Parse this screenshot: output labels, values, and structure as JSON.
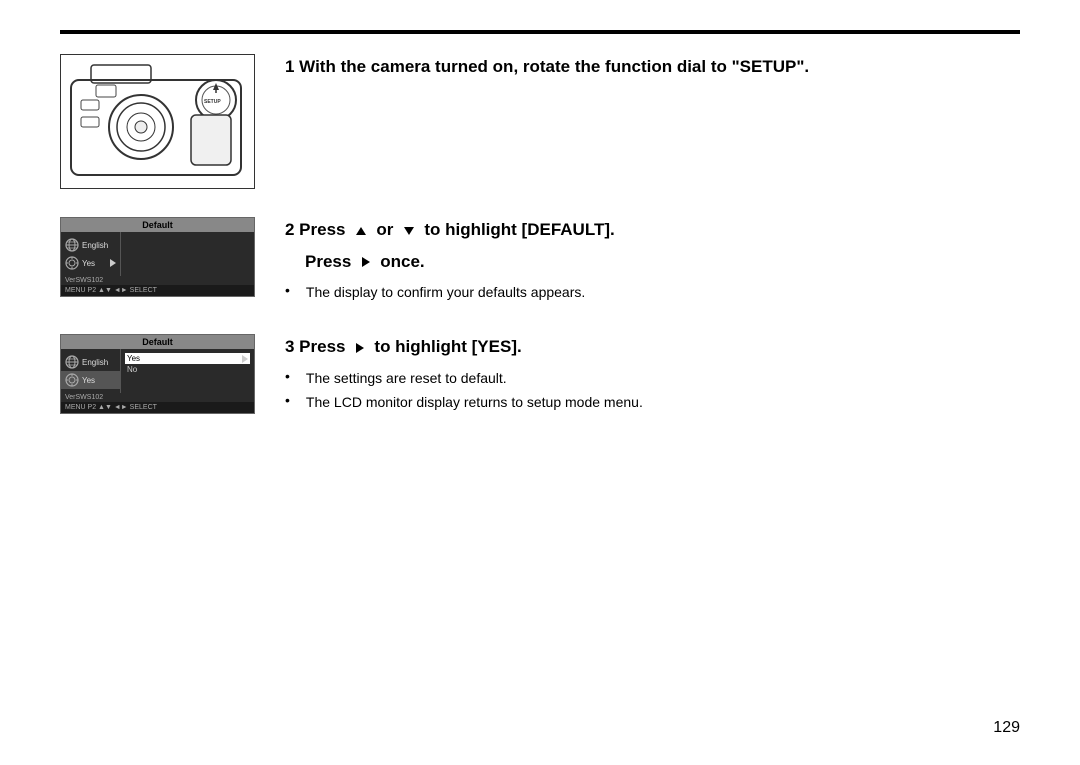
{
  "page": {
    "number": "129",
    "top_border": true
  },
  "step1": {
    "text": "1  With the camera turned on, rotate the function dial to \"SETUP\"."
  },
  "step2": {
    "instruction_line1_prefix": "2  Press",
    "instruction_line1_arrow1": "up",
    "instruction_line1_or": "or",
    "instruction_line1_arrow2": "down",
    "instruction_line1_suffix": "to highlight [DEFAULT].",
    "instruction_line2_prefix": "Press",
    "instruction_line2_arrow": "right",
    "instruction_line2_suffix": "once.",
    "bullet1": "The display to confirm your defaults appears.",
    "menu": {
      "header": "Default",
      "rows_left": [
        {
          "icon": "globe",
          "label": "English"
        },
        {
          "icon": "gear",
          "label": "Yes",
          "arrow": true
        }
      ],
      "version": "VerSWS102",
      "footer": "MENU P2  ▲▼  ◄► SELECT"
    }
  },
  "step3": {
    "instruction_line1_prefix": "3  Press",
    "instruction_line1_arrow": "right",
    "instruction_line1_suffix": "to highlight [YES].",
    "bullet1": "The settings are reset to default.",
    "bullet2": "The LCD monitor display returns to setup mode menu.",
    "menu": {
      "header": "Default",
      "rows_left": [
        {
          "icon": "globe",
          "label": "English"
        },
        {
          "icon": "gear",
          "label": "Yes",
          "arrow": false
        }
      ],
      "rows_right": [
        {
          "label": "Yes",
          "highlighted": true,
          "arrow": true
        },
        {
          "label": "No",
          "highlighted": false
        }
      ],
      "version": "VerSWS102",
      "footer": "MENU P2  ▲▼  ◄► SELECT"
    }
  }
}
